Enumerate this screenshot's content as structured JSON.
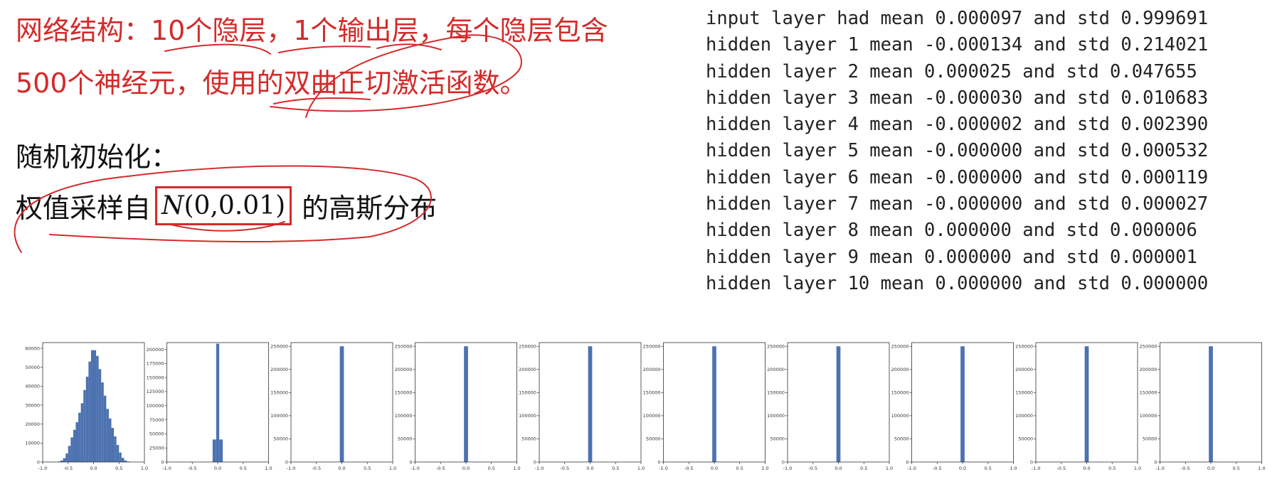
{
  "slide": {
    "network_line1": "网络结构：10个隐层，1个输出层，每个隐层包含",
    "network_line2": "500个神经元，使用的双曲正切激活函数。",
    "init_title": "随机初始化：",
    "weight_prefix": "权值采样自",
    "formula_var": "N",
    "formula_args": "(0,0.01)",
    "weight_suffix": "的高斯分布"
  },
  "log_lines": [
    "input layer had mean 0.000097 and std 0.999691",
    "hidden layer 1 mean -0.000134 and std 0.214021",
    "hidden layer 2 mean 0.000025 and std 0.047655",
    "hidden layer 3 mean -0.000030 and std 0.010683",
    "hidden layer 4 mean -0.000002 and std 0.002390",
    "hidden layer 5 mean -0.000000 and std 0.000532",
    "hidden layer 6 mean -0.000000 and std 0.000119",
    "hidden layer 7 mean -0.000000 and std 0.000027",
    "hidden layer 8 mean 0.000000 and std 0.000006",
    "hidden layer 9 mean 0.000000 and std 0.000001",
    "hidden layer 10 mean 0.000000 and std 0.000000"
  ],
  "colors": {
    "accent_red": "#d42a2a",
    "bar_blue": "#4c72b0",
    "text": "#111111"
  },
  "chart_data": [
    {
      "type": "bar",
      "xlim": [
        -1.0,
        1.0
      ],
      "ylim": [
        0,
        63000
      ],
      "x_ticks": [
        "-1.0",
        "-0.5",
        "0.0",
        "0.5",
        "1.0"
      ],
      "y_ticks": [
        "0",
        "10000",
        "20000",
        "30000",
        "40000",
        "50000",
        "60000"
      ],
      "bins": [
        {
          "x0": -0.7,
          "x1": -0.65,
          "count": 300
        },
        {
          "x0": -0.65,
          "x1": -0.6,
          "count": 800
        },
        {
          "x0": -0.6,
          "x1": -0.55,
          "count": 2000
        },
        {
          "x0": -0.55,
          "x1": -0.5,
          "count": 4500
        },
        {
          "x0": -0.5,
          "x1": -0.45,
          "count": 8500
        },
        {
          "x0": -0.45,
          "x1": -0.4,
          "count": 13000
        },
        {
          "x0": -0.4,
          "x1": -0.35,
          "count": 17000
        },
        {
          "x0": -0.35,
          "x1": -0.3,
          "count": 21000
        },
        {
          "x0": -0.3,
          "x1": -0.25,
          "count": 26000
        },
        {
          "x0": -0.25,
          "x1": -0.2,
          "count": 31000
        },
        {
          "x0": -0.2,
          "x1": -0.15,
          "count": 38000
        },
        {
          "x0": -0.15,
          "x1": -0.1,
          "count": 45000
        },
        {
          "x0": -0.1,
          "x1": -0.05,
          "count": 53000
        },
        {
          "x0": -0.05,
          "x1": 0.0,
          "count": 59000
        },
        {
          "x0": 0.0,
          "x1": 0.05,
          "count": 59000
        },
        {
          "x0": 0.05,
          "x1": 0.1,
          "count": 56000
        },
        {
          "x0": 0.1,
          "x1": 0.15,
          "count": 49000
        },
        {
          "x0": 0.15,
          "x1": 0.2,
          "count": 42000
        },
        {
          "x0": 0.2,
          "x1": 0.25,
          "count": 35000
        },
        {
          "x0": 0.25,
          "x1": 0.3,
          "count": 28000
        },
        {
          "x0": 0.3,
          "x1": 0.35,
          "count": 23000
        },
        {
          "x0": 0.35,
          "x1": 0.4,
          "count": 18000
        },
        {
          "x0": 0.4,
          "x1": 0.45,
          "count": 13500
        },
        {
          "x0": 0.45,
          "x1": 0.5,
          "count": 9000
        },
        {
          "x0": 0.5,
          "x1": 0.55,
          "count": 5000
        },
        {
          "x0": 0.55,
          "x1": 0.6,
          "count": 2200
        },
        {
          "x0": 0.6,
          "x1": 0.65,
          "count": 800
        },
        {
          "x0": 0.65,
          "x1": 0.7,
          "count": 300
        }
      ]
    },
    {
      "type": "bar",
      "xlim": [
        -1.0,
        1.0
      ],
      "ylim": [
        0,
        212000
      ],
      "x_ticks": [
        "-1.0",
        "-0.5",
        "0.0",
        "0.5",
        "1.0"
      ],
      "y_ticks": [
        "0",
        "25000",
        "50000",
        "75000",
        "100000",
        "125000",
        "150000",
        "175000",
        "200000"
      ],
      "bins": [
        {
          "x0": -0.1,
          "x1": -0.03,
          "count": 40000
        },
        {
          "x0": -0.03,
          "x1": 0.03,
          "count": 210000
        },
        {
          "x0": 0.03,
          "x1": 0.1,
          "count": 40000
        }
      ]
    },
    {
      "type": "bar",
      "xlim": [
        -1.0,
        1.0
      ],
      "ylim": [
        0,
        258000
      ],
      "x_ticks": [
        "-1.0",
        "-0.5",
        "0.0",
        "0.5",
        "1.0"
      ],
      "y_ticks": [
        "0",
        "50000",
        "100000",
        "150000",
        "200000",
        "250000"
      ],
      "bins": [
        {
          "x0": -0.04,
          "x1": 0.04,
          "count": 250000
        }
      ]
    },
    {
      "type": "bar",
      "xlim": [
        -1.0,
        1.0
      ],
      "ylim": [
        0,
        258000
      ],
      "x_ticks": [
        "-1.0",
        "-0.5",
        "0.0",
        "0.5",
        "1.0"
      ],
      "y_ticks": [
        "0",
        "50000",
        "100000",
        "150000",
        "200000",
        "250000"
      ],
      "bins": [
        {
          "x0": -0.04,
          "x1": 0.04,
          "count": 250000
        }
      ]
    },
    {
      "type": "bar",
      "xlim": [
        -1.0,
        1.0
      ],
      "ylim": [
        0,
        258000
      ],
      "x_ticks": [
        "-1.0",
        "-0.5",
        "0.0",
        "0.5",
        "1.0"
      ],
      "y_ticks": [
        "0",
        "50000",
        "100000",
        "150000",
        "200000",
        "250000"
      ],
      "bins": [
        {
          "x0": -0.04,
          "x1": 0.04,
          "count": 250000
        }
      ]
    },
    {
      "type": "bar",
      "xlim": [
        -1.0,
        1.0
      ],
      "ylim": [
        0,
        258000
      ],
      "x_ticks": [
        "-1.0",
        "-0.5",
        "0.0",
        "0.5",
        "1.0"
      ],
      "y_ticks": [
        "0",
        "50000",
        "100000",
        "150000",
        "200000",
        "250000"
      ],
      "bins": [
        {
          "x0": -0.04,
          "x1": 0.04,
          "count": 250000
        }
      ]
    },
    {
      "type": "bar",
      "xlim": [
        -1.0,
        1.0
      ],
      "ylim": [
        0,
        258000
      ],
      "x_ticks": [
        "-1.0",
        "-0.5",
        "0.0",
        "0.5",
        "1.0"
      ],
      "y_ticks": [
        "0",
        "50000",
        "100000",
        "150000",
        "200000",
        "250000"
      ],
      "bins": [
        {
          "x0": -0.04,
          "x1": 0.04,
          "count": 250000
        }
      ]
    },
    {
      "type": "bar",
      "xlim": [
        -1.0,
        1.0
      ],
      "ylim": [
        0,
        258000
      ],
      "x_ticks": [
        "-1.0",
        "-0.5",
        "0.0",
        "0.5",
        "1.0"
      ],
      "y_ticks": [
        "0",
        "50000",
        "100000",
        "150000",
        "200000",
        "250000"
      ],
      "bins": [
        {
          "x0": -0.04,
          "x1": 0.04,
          "count": 250000
        }
      ]
    },
    {
      "type": "bar",
      "xlim": [
        -1.0,
        1.0
      ],
      "ylim": [
        0,
        258000
      ],
      "x_ticks": [
        "-1.0",
        "-0.5",
        "0.0",
        "0.5",
        "1.0"
      ],
      "y_ticks": [
        "0",
        "50000",
        "100000",
        "150000",
        "200000",
        "250000"
      ],
      "bins": [
        {
          "x0": -0.04,
          "x1": 0.04,
          "count": 250000
        }
      ]
    },
    {
      "type": "bar",
      "xlim": [
        -1.0,
        1.0
      ],
      "ylim": [
        0,
        258000
      ],
      "x_ticks": [
        "-1.0",
        "-0.5",
        "0.0",
        "0.5",
        "1.0"
      ],
      "y_ticks": [
        "0",
        "50000",
        "100000",
        "150000",
        "200000",
        "250000"
      ],
      "bins": [
        {
          "x0": -0.04,
          "x1": 0.04,
          "count": 250000
        }
      ]
    }
  ]
}
